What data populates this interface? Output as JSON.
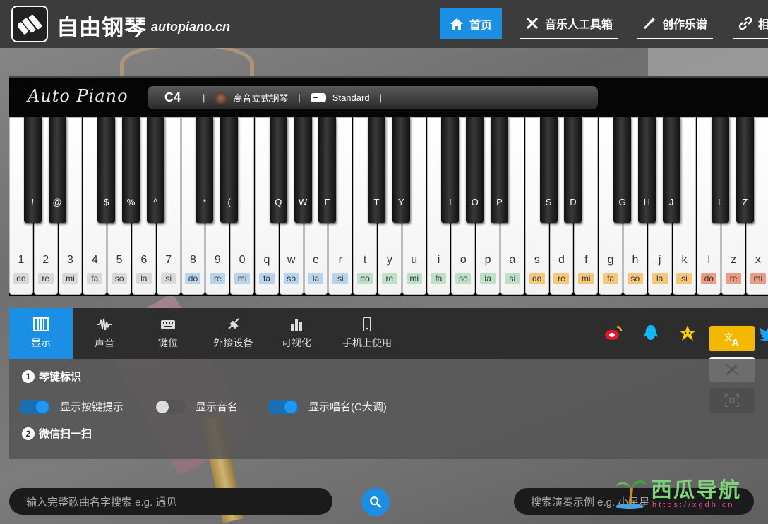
{
  "header": {
    "title": "自由钢琴",
    "domain": "autopiano.cn",
    "nav": [
      {
        "label": "首页",
        "icon": "home-icon"
      },
      {
        "label": "音乐人工具箱",
        "icon": "tools-icon"
      },
      {
        "label": "创作乐谱",
        "icon": "magic-wand-icon"
      },
      {
        "label": "相",
        "icon": "link-icon"
      }
    ]
  },
  "piano": {
    "script_logo": "Auto Piano",
    "current_note": "C4",
    "instrument": "高音立式钢琴",
    "mode": "Standard",
    "white_keys": [
      {
        "key": "1",
        "solf": "do",
        "color": "#d9d9d9"
      },
      {
        "key": "2",
        "solf": "re",
        "color": "#d9d9d9"
      },
      {
        "key": "3",
        "solf": "mi",
        "color": "#d9d9d9"
      },
      {
        "key": "4",
        "solf": "fa",
        "color": "#d9d9d9"
      },
      {
        "key": "5",
        "solf": "so",
        "color": "#d9d9d9"
      },
      {
        "key": "6",
        "solf": "la",
        "color": "#d9d9d9"
      },
      {
        "key": "7",
        "solf": "si",
        "color": "#d9d9d9"
      },
      {
        "key": "8",
        "solf": "do",
        "color": "#b9d3ea"
      },
      {
        "key": "9",
        "solf": "re",
        "color": "#b9d3ea"
      },
      {
        "key": "0",
        "solf": "mi",
        "color": "#b9d3ea"
      },
      {
        "key": "q",
        "solf": "fa",
        "color": "#b9d3ea"
      },
      {
        "key": "w",
        "solf": "so",
        "color": "#b9d3ea"
      },
      {
        "key": "e",
        "solf": "la",
        "color": "#b9d3ea"
      },
      {
        "key": "r",
        "solf": "si",
        "color": "#b9d3ea"
      },
      {
        "key": "t",
        "solf": "do",
        "color": "#bfe0c8"
      },
      {
        "key": "y",
        "solf": "re",
        "color": "#bfe0c8"
      },
      {
        "key": "u",
        "solf": "mi",
        "color": "#bfe0c8"
      },
      {
        "key": "i",
        "solf": "fa",
        "color": "#bfe0c8"
      },
      {
        "key": "o",
        "solf": "so",
        "color": "#bfe0c8"
      },
      {
        "key": "p",
        "solf": "la",
        "color": "#bfe0c8"
      },
      {
        "key": "a",
        "solf": "si",
        "color": "#bfe0c8"
      },
      {
        "key": "s",
        "solf": "do",
        "color": "#f6c77a"
      },
      {
        "key": "d",
        "solf": "re",
        "color": "#f6c77a"
      },
      {
        "key": "f",
        "solf": "mi",
        "color": "#f6c77a"
      },
      {
        "key": "g",
        "solf": "fa",
        "color": "#f6c77a"
      },
      {
        "key": "h",
        "solf": "so",
        "color": "#f6c77a"
      },
      {
        "key": "j",
        "solf": "la",
        "color": "#f6c77a"
      },
      {
        "key": "k",
        "solf": "si",
        "color": "#f6c77a"
      },
      {
        "key": "l",
        "solf": "do",
        "color": "#ef9a82"
      },
      {
        "key": "z",
        "solf": "re",
        "color": "#ef9a82"
      },
      {
        "key": "x",
        "solf": "mi",
        "color": "#ef9a82"
      }
    ],
    "black_keys": [
      {
        "key": "!",
        "after": 0
      },
      {
        "key": "@",
        "after": 1
      },
      {
        "key": "$",
        "after": 3
      },
      {
        "key": "%",
        "after": 4
      },
      {
        "key": "^",
        "after": 5
      },
      {
        "key": "*",
        "after": 7
      },
      {
        "key": "(",
        "after": 8
      },
      {
        "key": "Q",
        "after": 10
      },
      {
        "key": "W",
        "after": 11
      },
      {
        "key": "E",
        "after": 12
      },
      {
        "key": "T",
        "after": 14
      },
      {
        "key": "Y",
        "after": 15
      },
      {
        "key": "I",
        "after": 17
      },
      {
        "key": "O",
        "after": 18
      },
      {
        "key": "P",
        "after": 19
      },
      {
        "key": "S",
        "after": 21
      },
      {
        "key": "D",
        "after": 22
      },
      {
        "key": "G",
        "after": 24
      },
      {
        "key": "H",
        "after": 25
      },
      {
        "key": "J",
        "after": 26
      },
      {
        "key": "L",
        "after": 28
      },
      {
        "key": "Z",
        "after": 29
      }
    ]
  },
  "tabs": [
    {
      "label": "显示",
      "icon": "piano-keys-icon",
      "active": true
    },
    {
      "label": "声音",
      "icon": "waveform-icon"
    },
    {
      "label": "键位",
      "icon": "keyboard-icon"
    },
    {
      "label": "外接设备",
      "icon": "plug-icon"
    },
    {
      "label": "可视化",
      "icon": "bar-chart-icon"
    },
    {
      "label": "手机上使用",
      "icon": "phone-icon"
    }
  ],
  "settings": {
    "section1": {
      "num": "1",
      "title": "琴键标识"
    },
    "section2": {
      "num": "2",
      "title": "微信扫一扫"
    },
    "toggles": [
      {
        "label": "显示按键提示",
        "on": true
      },
      {
        "label": "显示音名",
        "on": false
      },
      {
        "label": "显示唱名(C大调)",
        "on": true
      }
    ]
  },
  "search": {
    "song_placeholder": "输入完整歌曲名字搜索  e.g. 遇见",
    "demo_placeholder": "搜索演奏示例  e.g. 小星星"
  },
  "watermark": {
    "text": "西瓜导航",
    "url": "https://xgdh.cn"
  },
  "colors": {
    "accent": "#1a8fe3",
    "translate_button": "#f5b800"
  }
}
